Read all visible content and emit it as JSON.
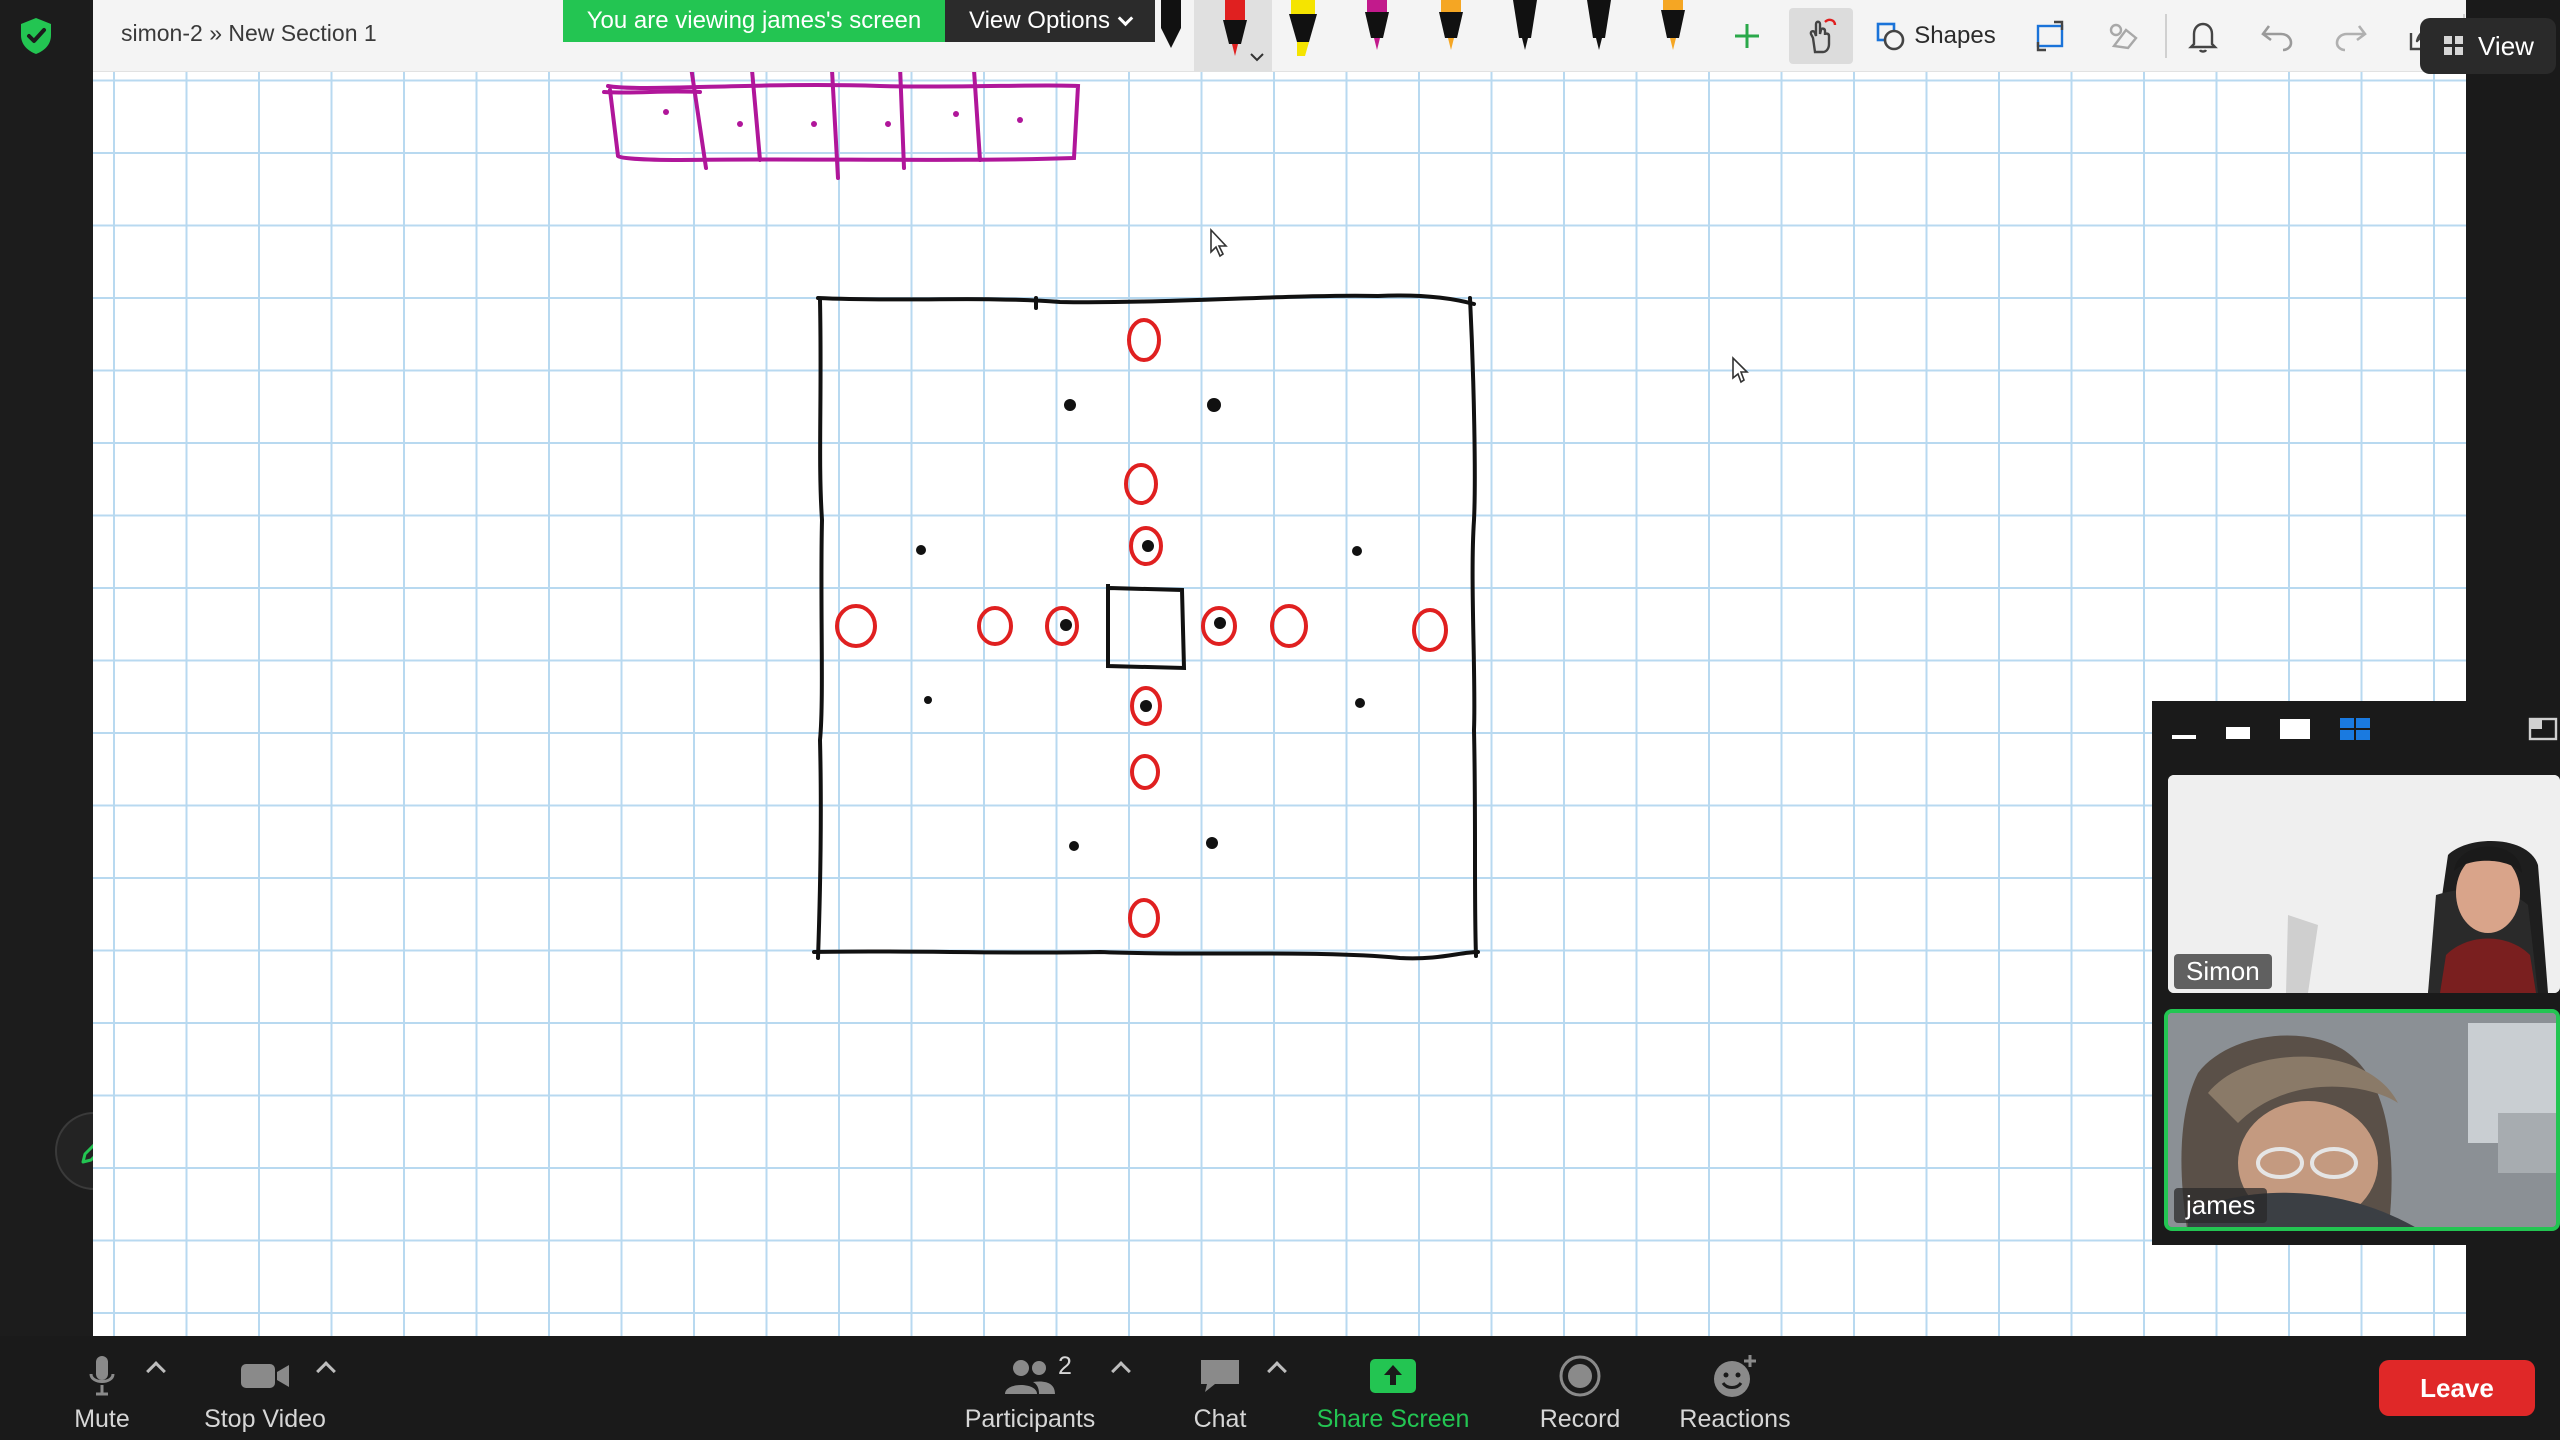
{
  "title_bar": {
    "document_title": "simon-2 » New Section 1",
    "viewing_banner": "You are viewing james's screen",
    "view_options_label": "View Options",
    "shapes_label": "Shapes",
    "view_label": "View"
  },
  "toolbar": {
    "pens": [
      {
        "name": "black-pen",
        "color": "#111111"
      },
      {
        "name": "red-pen",
        "color": "#e02020",
        "active": true
      },
      {
        "name": "yellow-highlighter",
        "color": "#f5e400"
      },
      {
        "name": "magenta-pen",
        "color": "#c21a8c"
      },
      {
        "name": "orange-pen",
        "color": "#f5a623"
      },
      {
        "name": "black-pen-2",
        "color": "#111111"
      },
      {
        "name": "black-pen-3",
        "color": "#111111"
      },
      {
        "name": "orange-pen-2",
        "color": "#f5a623"
      }
    ],
    "icons": [
      "add-icon",
      "hand-pointer-icon",
      "shapes-icon",
      "select-icon",
      "eraser-icon",
      "bell-icon",
      "undo-icon",
      "redo-icon",
      "share-icon",
      "collapse-icon"
    ]
  },
  "video_panel": {
    "participants": [
      {
        "name": "Simon",
        "active_speaker": false
      },
      {
        "name": "james",
        "active_speaker": true
      }
    ],
    "layout_icons": [
      "minimize-icon",
      "speaker-strip-icon",
      "speaker-view-icon",
      "gallery-view-icon",
      "expand-icon"
    ]
  },
  "meeting_bar": {
    "mute_label": "Mute",
    "stop_video_label": "Stop Video",
    "participants_label": "Participants",
    "participants_count": "2",
    "chat_label": "Chat",
    "share_screen_label": "Share Screen",
    "record_label": "Record",
    "reactions_label": "Reactions",
    "leave_label": "Leave"
  },
  "colors": {
    "grid_line": "#b8d9f0",
    "ink_black": "#111111",
    "ink_red": "#e02020",
    "ink_magenta": "#b0169a",
    "share_green": "#23c552",
    "leave_red": "#e02828"
  }
}
